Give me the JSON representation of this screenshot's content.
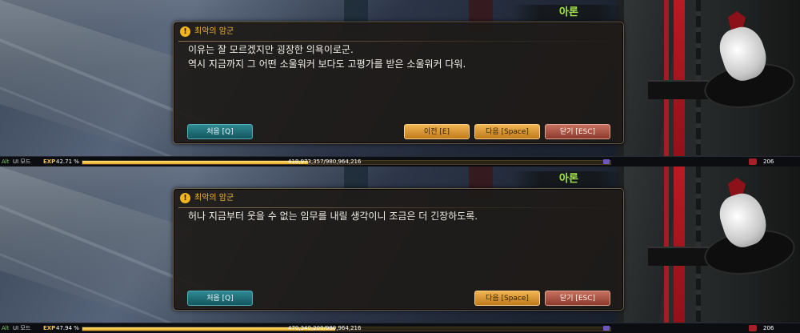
{
  "panels": [
    {
      "speaker": "아론",
      "dialog": {
        "title": "최악의 암군",
        "lines": [
          "이유는 잘 모르겠지만 굉장한 의욕이로군.",
          "역시 지금까지 그 어떤 소울워커 보다도 고평가를 받은 소울워커 다워."
        ],
        "buttons": {
          "first": "처음 [Q]",
          "prev": "이전 [E]",
          "next": "다음 [Space]",
          "close": "닫기 [ESC]"
        }
      },
      "expbar": {
        "alt": "Alt",
        "ui_mode": "UI 모드",
        "exp_label": "EXP",
        "percent": "42.71 %",
        "percent_value": 42.71,
        "numbers": "418,973,357/980,964,216",
        "level": "206"
      }
    },
    {
      "speaker": "아론",
      "dialog": {
        "title": "최악의 암군",
        "lines": [
          "허나 지금부터 웃을 수 없는 임무를 내릴 생각이니 조금은 더 긴장하도록."
        ],
        "buttons": {
          "first": "처음 [Q]",
          "next": "다음 [Space]",
          "close": "닫기 [ESC]"
        }
      },
      "expbar": {
        "alt": "Alt",
        "ui_mode": "UI 모드",
        "exp_label": "EXP",
        "percent": "47.94 %",
        "percent_value": 47.94,
        "numbers": "470,340,209/980,964,216",
        "level": "206"
      }
    }
  ],
  "icons": {
    "warning": "warning-icon",
    "level": "level-badge-icon",
    "mini": "quickslot-icon"
  },
  "colors": {
    "speaker": "#a4e24b",
    "title": "#f0b43a",
    "exp_fill": "#e6a41d"
  }
}
